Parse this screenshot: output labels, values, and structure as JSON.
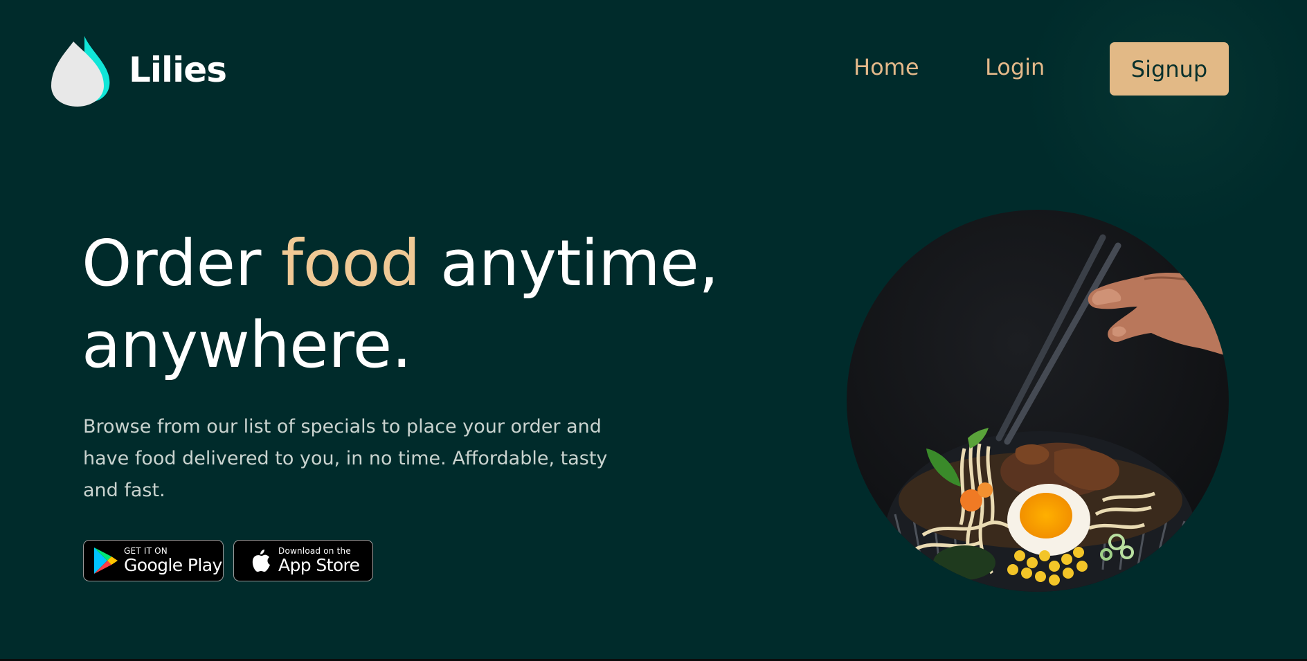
{
  "header": {
    "brand": "Lilies",
    "nav": {
      "home": "Home",
      "login": "Login",
      "signup": "Signup"
    }
  },
  "hero": {
    "title_part1": "Order ",
    "title_accent": "food",
    "title_part2": " anytime,",
    "title_line2": "anywhere.",
    "description": "Browse from our list of specials to place your order and have food delivered to you, in no time. Affordable, tasty and fast."
  },
  "stores": {
    "google": {
      "small": "GET IT ON",
      "big": "Google Play"
    },
    "apple": {
      "small": "Download on the",
      "big": "App Store"
    }
  },
  "colors": {
    "background": "#002b2b",
    "accent": "#e2b986",
    "logo_teal": "#1de5d8"
  },
  "icons": {
    "logo": "leaf-drop-logo",
    "google": "google-play-icon",
    "apple": "apple-icon"
  }
}
